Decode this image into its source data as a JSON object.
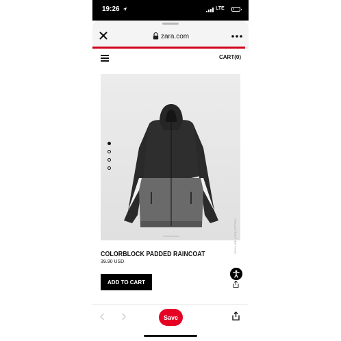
{
  "status_bar": {
    "time": "19:26",
    "network": "LTE",
    "battery_level": 0.15,
    "battery_color": "#ff3b30"
  },
  "browser": {
    "url": "zara.com",
    "close_icon": "close-icon",
    "lock_icon": "lock-icon",
    "more_icon": "more-icon",
    "load_progress": 0.98,
    "progress_color": "#d0021b"
  },
  "header": {
    "menu_icon": "hamburger-icon",
    "cart_label": "CART(0)"
  },
  "product": {
    "image_caption": "JOIN LIFE | COLLECTION",
    "gallery_dots": 4,
    "active_dot": 0,
    "name": "COLORBLOCK PADDED RAINCOAT",
    "price": "39.90 USD",
    "add_to_cart_label": "ADD TO CART"
  },
  "toolbar": {
    "save_label": "Save",
    "save_color": "#e60023",
    "back_icon": "chevron-left-icon",
    "forward_icon": "chevron-right-icon",
    "share_icon": "share-icon"
  }
}
